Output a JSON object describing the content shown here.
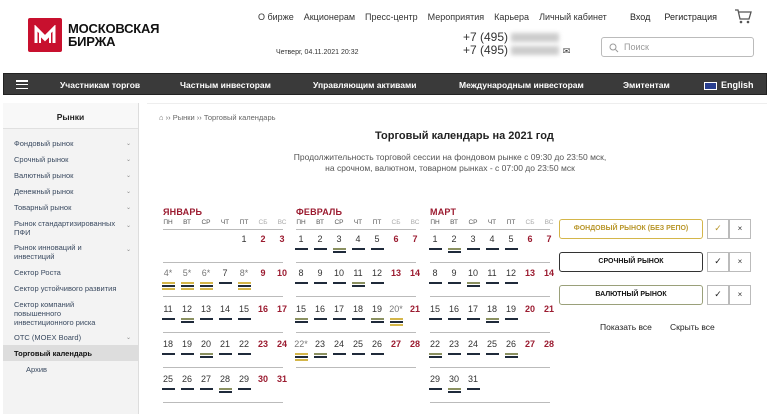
{
  "header": {
    "logo_line1": "МОСКОВСКАЯ",
    "logo_line2": "БИРЖА",
    "topnav": [
      "О бирже",
      "Акционерам",
      "Пресс-центр",
      "Мероприятия",
      "Карьера",
      "Личный кабинет"
    ],
    "login": "Вход",
    "register": "Регистрация",
    "date": "Четверг, 04.11.2021 20:32",
    "phone1": "+7 (495)",
    "phone2": "+7 (495)",
    "search_placeholder": "Поиск"
  },
  "mainnav": {
    "items": [
      "Участникам торгов",
      "Частным инвесторам",
      "Управляющим активами",
      "Международным инвесторам",
      "Эмитентам"
    ],
    "language": "English"
  },
  "sidebar": {
    "title": "Рынки",
    "items": [
      "Фондовый рынок",
      "Срочный рынок",
      "Валютный рынок",
      "Денежный рынок",
      "Товарный рынок",
      "Рынок стандартизированных ПФИ",
      "Рынок инноваций и инвестиций",
      "Сектор Роста",
      "Сектор устойчивого развития",
      "Сектор компаний повышенного инвестиционного риска",
      "OTC (MOEX Board)",
      "Торговый календарь",
      "Архив"
    ]
  },
  "breadcrumb": {
    "home": "Рынки",
    "current": "Торговый календарь"
  },
  "page": {
    "title": "Торговый календарь на 2021 год",
    "subtitle1": "Продолжительность торговой сессии на фондовом рынке с 09:30 до 23:50 мск,",
    "subtitle2": "на срочном, валютном, товарном рынках - с 07:00 до 23:50 мск"
  },
  "calendar": {
    "dow": [
      "ПН",
      "ВТ",
      "СР",
      "ЧТ",
      "ПТ",
      "СБ",
      "ВС"
    ],
    "months": [
      {
        "name": "ЯНВАРЬ",
        "rows": [
          [
            "",
            "",
            "",
            "",
            "1",
            "2",
            "3"
          ],
          [
            "4*",
            "5*",
            "6*",
            "7",
            "8*",
            "9",
            "10"
          ],
          [
            "11",
            "12",
            "13",
            "14",
            "15",
            "16",
            "17"
          ],
          [
            "18",
            "19",
            "20",
            "21",
            "22",
            "23",
            "24"
          ],
          [
            "25",
            "26",
            "27",
            "28",
            "29",
            "30",
            "31"
          ]
        ]
      },
      {
        "name": "ФЕВРАЛЬ",
        "rows": [
          [
            "1",
            "2",
            "3",
            "4",
            "5",
            "6",
            "7"
          ],
          [
            "8",
            "9",
            "10",
            "11",
            "12",
            "13",
            "14"
          ],
          [
            "15",
            "16",
            "17",
            "18",
            "19",
            "20*",
            "21"
          ],
          [
            "22*",
            "23",
            "24",
            "25",
            "26",
            "27",
            "28"
          ]
        ]
      },
      {
        "name": "МАРТ",
        "rows": [
          [
            "1",
            "2",
            "3",
            "4",
            "5",
            "6",
            "7"
          ],
          [
            "8",
            "9",
            "10",
            "11",
            "12",
            "13",
            "14"
          ],
          [
            "15",
            "16",
            "17",
            "18",
            "19",
            "20",
            "21"
          ],
          [
            "22",
            "23",
            "24",
            "25",
            "26",
            "27",
            "28"
          ],
          [
            "29",
            "30",
            "31",
            "",
            "",
            "",
            ""
          ]
        ]
      }
    ]
  },
  "filters": {
    "items": [
      "ФОНДОВЫЙ РЫНОК (БЕЗ РЕПО)",
      "СРОЧНЫЙ РЫНОК",
      "ВАЛЮТНЫЙ РЫНОК"
    ],
    "check": "✓",
    "close": "×",
    "show_all": "Показать все",
    "hide_all": "Скрыть все"
  },
  "colors": {
    "brand": "#c8102e",
    "weekend": "#9b1b30",
    "stock": "#d4b64a",
    "derivatives": "#1f2a3a",
    "fx": "#8a9060"
  }
}
